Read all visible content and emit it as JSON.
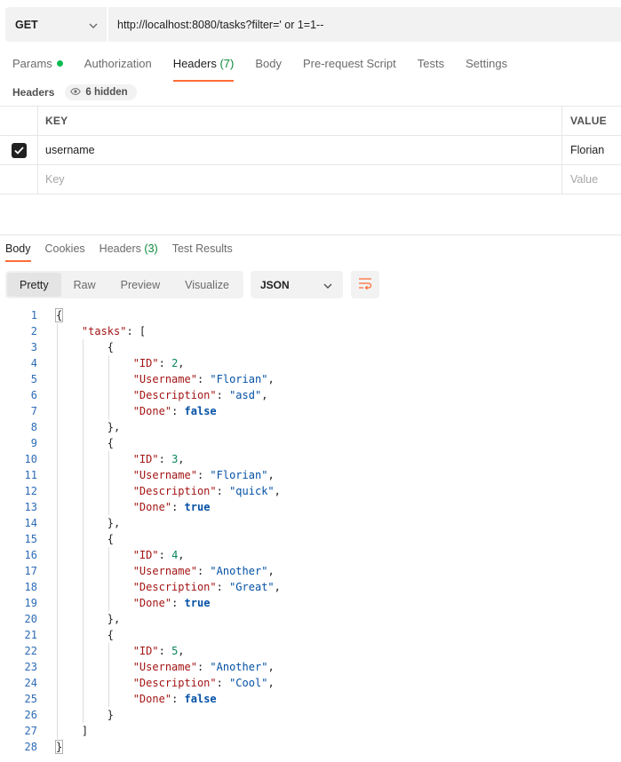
{
  "request": {
    "method": "GET",
    "url": "http://localhost:8080/tasks?filter=' or 1=1--"
  },
  "request_tabs": [
    {
      "label": "Params",
      "dot": true
    },
    {
      "label": "Authorization"
    },
    {
      "label": "Headers",
      "count": "(7)",
      "active": true
    },
    {
      "label": "Body"
    },
    {
      "label": "Pre-request Script"
    },
    {
      "label": "Tests"
    },
    {
      "label": "Settings"
    }
  ],
  "headers_section": {
    "label": "Headers",
    "hidden": "6 hidden"
  },
  "headers_table": {
    "col_key": "KEY",
    "col_value": "VALUE",
    "rows": [
      {
        "key": "username",
        "value": "Florian",
        "checked": true
      }
    ],
    "placeholder_key": "Key",
    "placeholder_value": "Value"
  },
  "response_tabs": [
    {
      "label": "Body",
      "active": true
    },
    {
      "label": "Cookies"
    },
    {
      "label": "Headers",
      "count": "(3)"
    },
    {
      "label": "Test Results"
    }
  ],
  "view_modes": [
    "Pretty",
    "Raw",
    "Preview",
    "Visualize"
  ],
  "active_view_mode": "Pretty",
  "format": "JSON",
  "colors": {
    "accent": "#ff6c37",
    "status_dot": "#0cbb52",
    "json_key": "#a31515",
    "json_string": "#0451a5",
    "json_number": "#098658"
  },
  "response_lines": [
    [
      [
        "p",
        "{"
      ]
    ],
    [
      [
        "p",
        "    "
      ],
      [
        "k",
        "\"tasks\""
      ],
      [
        "p",
        ": ["
      ]
    ],
    [
      [
        "p",
        "        {"
      ]
    ],
    [
      [
        "p",
        "            "
      ],
      [
        "k",
        "\"ID\""
      ],
      [
        "p",
        ": "
      ],
      [
        "n",
        "2"
      ],
      [
        "p",
        ","
      ]
    ],
    [
      [
        "p",
        "            "
      ],
      [
        "k",
        "\"Username\""
      ],
      [
        "p",
        ": "
      ],
      [
        "s",
        "\"Florian\""
      ],
      [
        "p",
        ","
      ]
    ],
    [
      [
        "p",
        "            "
      ],
      [
        "k",
        "\"Description\""
      ],
      [
        "p",
        ": "
      ],
      [
        "s",
        "\"asd\""
      ],
      [
        "p",
        ","
      ]
    ],
    [
      [
        "p",
        "            "
      ],
      [
        "k",
        "\"Done\""
      ],
      [
        "p",
        ": "
      ],
      [
        "b",
        "false"
      ]
    ],
    [
      [
        "p",
        "        },"
      ]
    ],
    [
      [
        "p",
        "        {"
      ]
    ],
    [
      [
        "p",
        "            "
      ],
      [
        "k",
        "\"ID\""
      ],
      [
        "p",
        ": "
      ],
      [
        "n",
        "3"
      ],
      [
        "p",
        ","
      ]
    ],
    [
      [
        "p",
        "            "
      ],
      [
        "k",
        "\"Username\""
      ],
      [
        "p",
        ": "
      ],
      [
        "s",
        "\"Florian\""
      ],
      [
        "p",
        ","
      ]
    ],
    [
      [
        "p",
        "            "
      ],
      [
        "k",
        "\"Description\""
      ],
      [
        "p",
        ": "
      ],
      [
        "s",
        "\"quick\""
      ],
      [
        "p",
        ","
      ]
    ],
    [
      [
        "p",
        "            "
      ],
      [
        "k",
        "\"Done\""
      ],
      [
        "p",
        ": "
      ],
      [
        "b",
        "true"
      ]
    ],
    [
      [
        "p",
        "        },"
      ]
    ],
    [
      [
        "p",
        "        {"
      ]
    ],
    [
      [
        "p",
        "            "
      ],
      [
        "k",
        "\"ID\""
      ],
      [
        "p",
        ": "
      ],
      [
        "n",
        "4"
      ],
      [
        "p",
        ","
      ]
    ],
    [
      [
        "p",
        "            "
      ],
      [
        "k",
        "\"Username\""
      ],
      [
        "p",
        ": "
      ],
      [
        "s",
        "\"Another\""
      ],
      [
        "p",
        ","
      ]
    ],
    [
      [
        "p",
        "            "
      ],
      [
        "k",
        "\"Description\""
      ],
      [
        "p",
        ": "
      ],
      [
        "s",
        "\"Great\""
      ],
      [
        "p",
        ","
      ]
    ],
    [
      [
        "p",
        "            "
      ],
      [
        "k",
        "\"Done\""
      ],
      [
        "p",
        ": "
      ],
      [
        "b",
        "true"
      ]
    ],
    [
      [
        "p",
        "        },"
      ]
    ],
    [
      [
        "p",
        "        {"
      ]
    ],
    [
      [
        "p",
        "            "
      ],
      [
        "k",
        "\"ID\""
      ],
      [
        "p",
        ": "
      ],
      [
        "n",
        "5"
      ],
      [
        "p",
        ","
      ]
    ],
    [
      [
        "p",
        "            "
      ],
      [
        "k",
        "\"Username\""
      ],
      [
        "p",
        ": "
      ],
      [
        "s",
        "\"Another\""
      ],
      [
        "p",
        ","
      ]
    ],
    [
      [
        "p",
        "            "
      ],
      [
        "k",
        "\"Description\""
      ],
      [
        "p",
        ": "
      ],
      [
        "s",
        "\"Cool\""
      ],
      [
        "p",
        ","
      ]
    ],
    [
      [
        "p",
        "            "
      ],
      [
        "k",
        "\"Done\""
      ],
      [
        "p",
        ": "
      ],
      [
        "b",
        "false"
      ]
    ],
    [
      [
        "p",
        "        }"
      ]
    ],
    [
      [
        "p",
        "    ]"
      ]
    ],
    [
      [
        "p",
        "}"
      ]
    ]
  ],
  "icons": {
    "method_dropdown": "chevron-down-icon",
    "hidden": "eye-icon",
    "format_dropdown": "chevron-down-icon",
    "wrap": "wrap-lines-icon",
    "check": "checkbox-checked-icon"
  }
}
